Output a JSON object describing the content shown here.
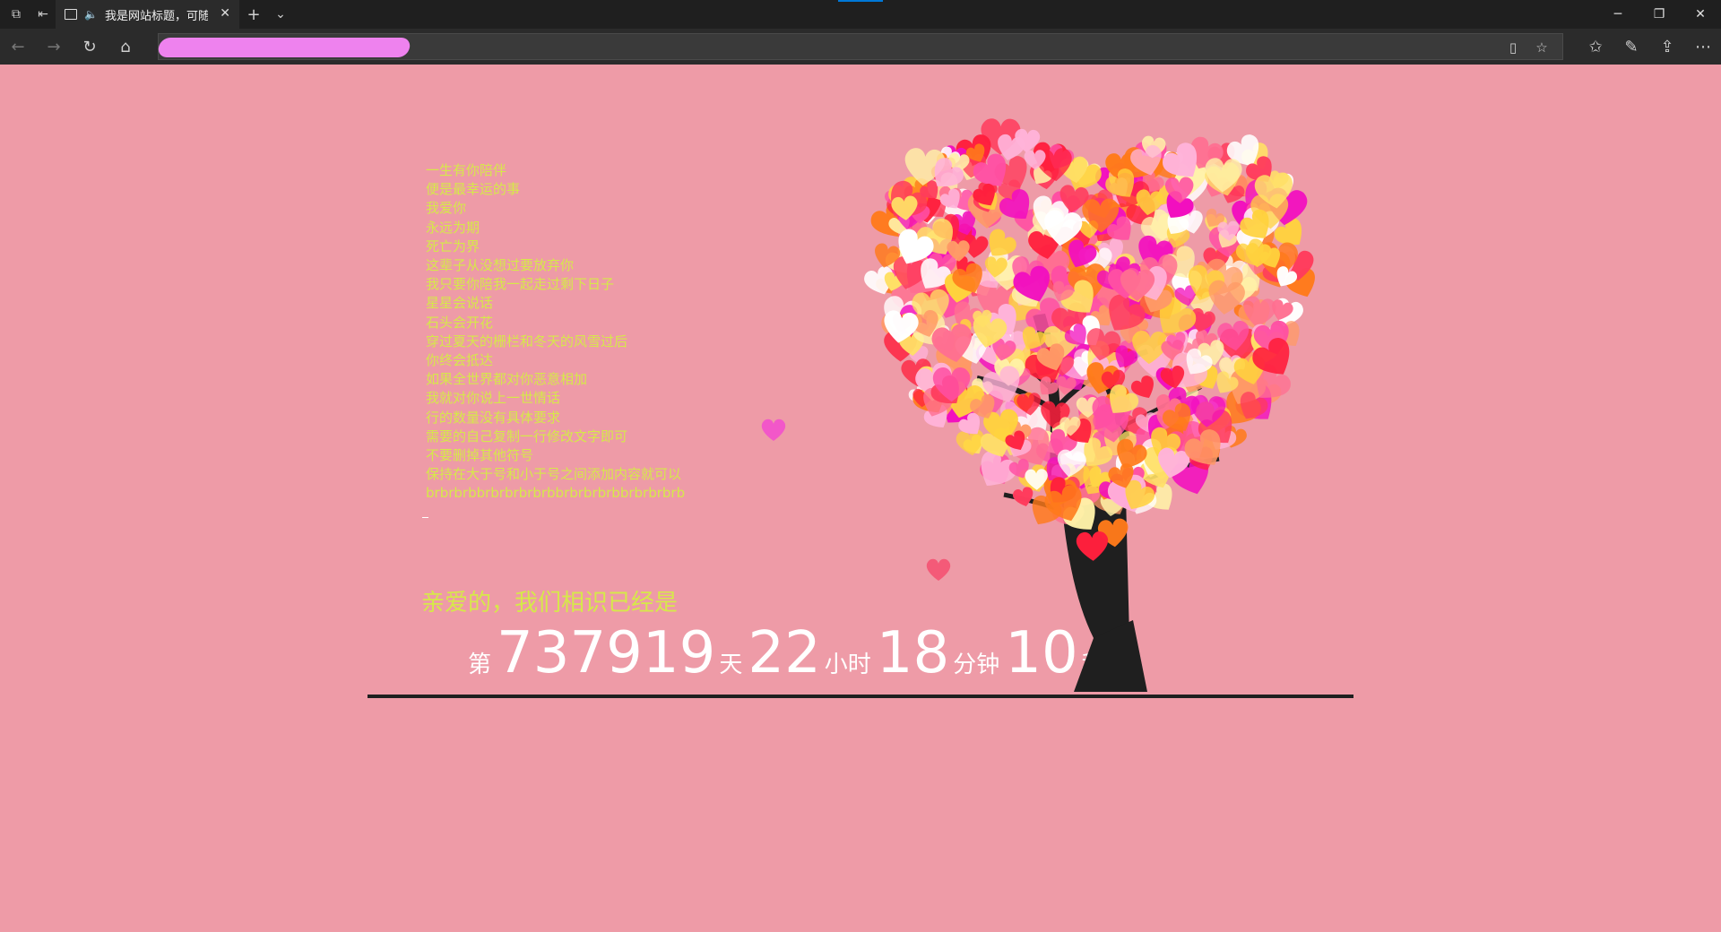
{
  "tab": {
    "title": "我是网站标题，可随"
  },
  "page": {
    "poem": [
      "一生有你陪伴",
      "便是最幸运的事",
      "我爱你",
      "永远为期",
      "死亡为界",
      "这辈子从没想过要放弃你",
      "我只要你陪我一起走过剩下日子",
      "星星会说话",
      "石头会开花",
      "穿过夏天的栅栏和冬天的风雪过后",
      "你终会抵达",
      "如果全世界都对你恶意相加",
      "我就对你说上一世情话",
      "行的数量没有具体要求",
      "需要的自己复制一行修改文字即可",
      "不要删掉其他符号",
      "保持在大于号和小于号之间添加内容就可以",
      "brbrbrbbrbrbrbrbrbbrbrbrbrbbrbrbrbrb"
    ],
    "together_text": "亲爱的，我们相识已经是",
    "counter": {
      "prefix": "第",
      "days": "737919",
      "days_unit": "天",
      "hours": "22",
      "hours_unit": "小时",
      "minutes": "18",
      "minutes_unit": "分钟",
      "seconds": "10",
      "seconds_unit": "秒"
    }
  },
  "colors": {
    "background": "#ee9ba7",
    "text_yellow": "#d6e84a",
    "counter_white": "#ffffff",
    "trunk": "#1f1f1f"
  }
}
